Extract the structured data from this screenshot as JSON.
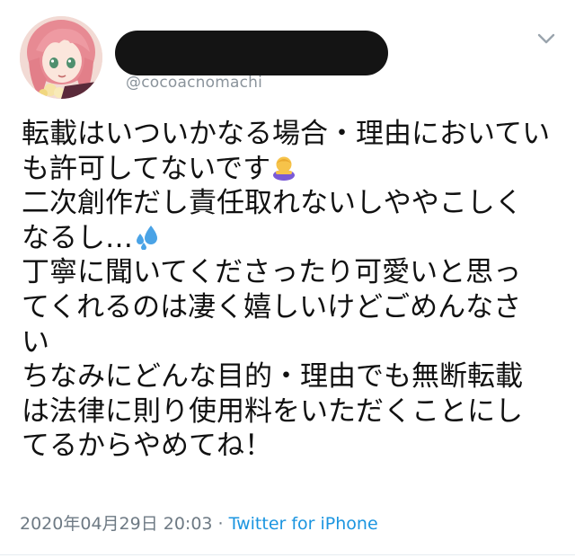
{
  "tweet": {
    "author": {
      "handle": "@cocoacnomachi"
    },
    "body_lines": [
      "転載はいついかなる場合・理由においてい",
      "も許可してないです",
      "二次創作だし責任取れないしややこしく",
      "なるし…",
      "丁寧に聞いてくださったり可愛いと思っ",
      "てくれるのは凄く嬉しいけどごめんなさ",
      "い",
      "ちなみにどんな目的・理由でも無断転載",
      "は法律に則り使用料をいただくことにし",
      "てるからやめてね！"
    ],
    "emoji": {
      "line2": "person-bowing-emoji",
      "line4": "sweat-droplets-emoji"
    },
    "timestamp": "2020年04月29日 20:03",
    "separator": " · ",
    "source": "Twitter for iPhone"
  },
  "colors": {
    "text": "#111111",
    "handle": "#8a939b",
    "meta": "#6e7a84",
    "link": "#1b95e0",
    "redaction": "#141414"
  }
}
